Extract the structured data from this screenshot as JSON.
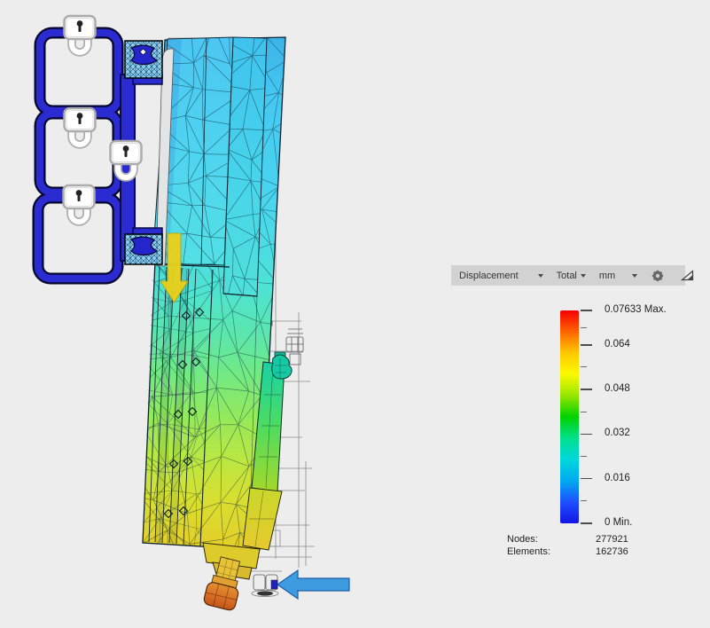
{
  "toolbar": {
    "result_dropdown": "Displacement",
    "component_dropdown": "Total",
    "unit_dropdown": "mm"
  },
  "legend": {
    "ticks": [
      {
        "label": "0.07633 Max.",
        "value": 0.07633
      },
      {
        "label": "0.064",
        "value": 0.064
      },
      {
        "label": "0.048",
        "value": 0.048
      },
      {
        "label": "0.032",
        "value": 0.032
      },
      {
        "label": "0.016",
        "value": 0.016
      },
      {
        "label": "0 Min.",
        "value": 0
      }
    ],
    "gradient": [
      "#f40000",
      "#ff6400",
      "#ffc800",
      "#fafa00",
      "#96e600",
      "#00d200",
      "#00e08c",
      "#00d8dc",
      "#00aaf0",
      "#1e50ff",
      "#1414e6"
    ]
  },
  "stats": {
    "nodes_label": "Nodes:",
    "nodes_value": "277921",
    "elements_label": "Elements:",
    "elements_value": "162736"
  },
  "icons": {
    "dropdown": "chevron-down-icon",
    "settings": "gear-icon",
    "legend_toggle": "legend-triangle-icon",
    "constraint": "lock-icon"
  },
  "colors": {
    "constraint_blue": "#2b2bd2",
    "load_arrow_yellow": "#e9d01b",
    "force_arrow_blue": "#3f9be0",
    "toolbar_bg": "#d2d2d2",
    "background": "#ededee"
  }
}
